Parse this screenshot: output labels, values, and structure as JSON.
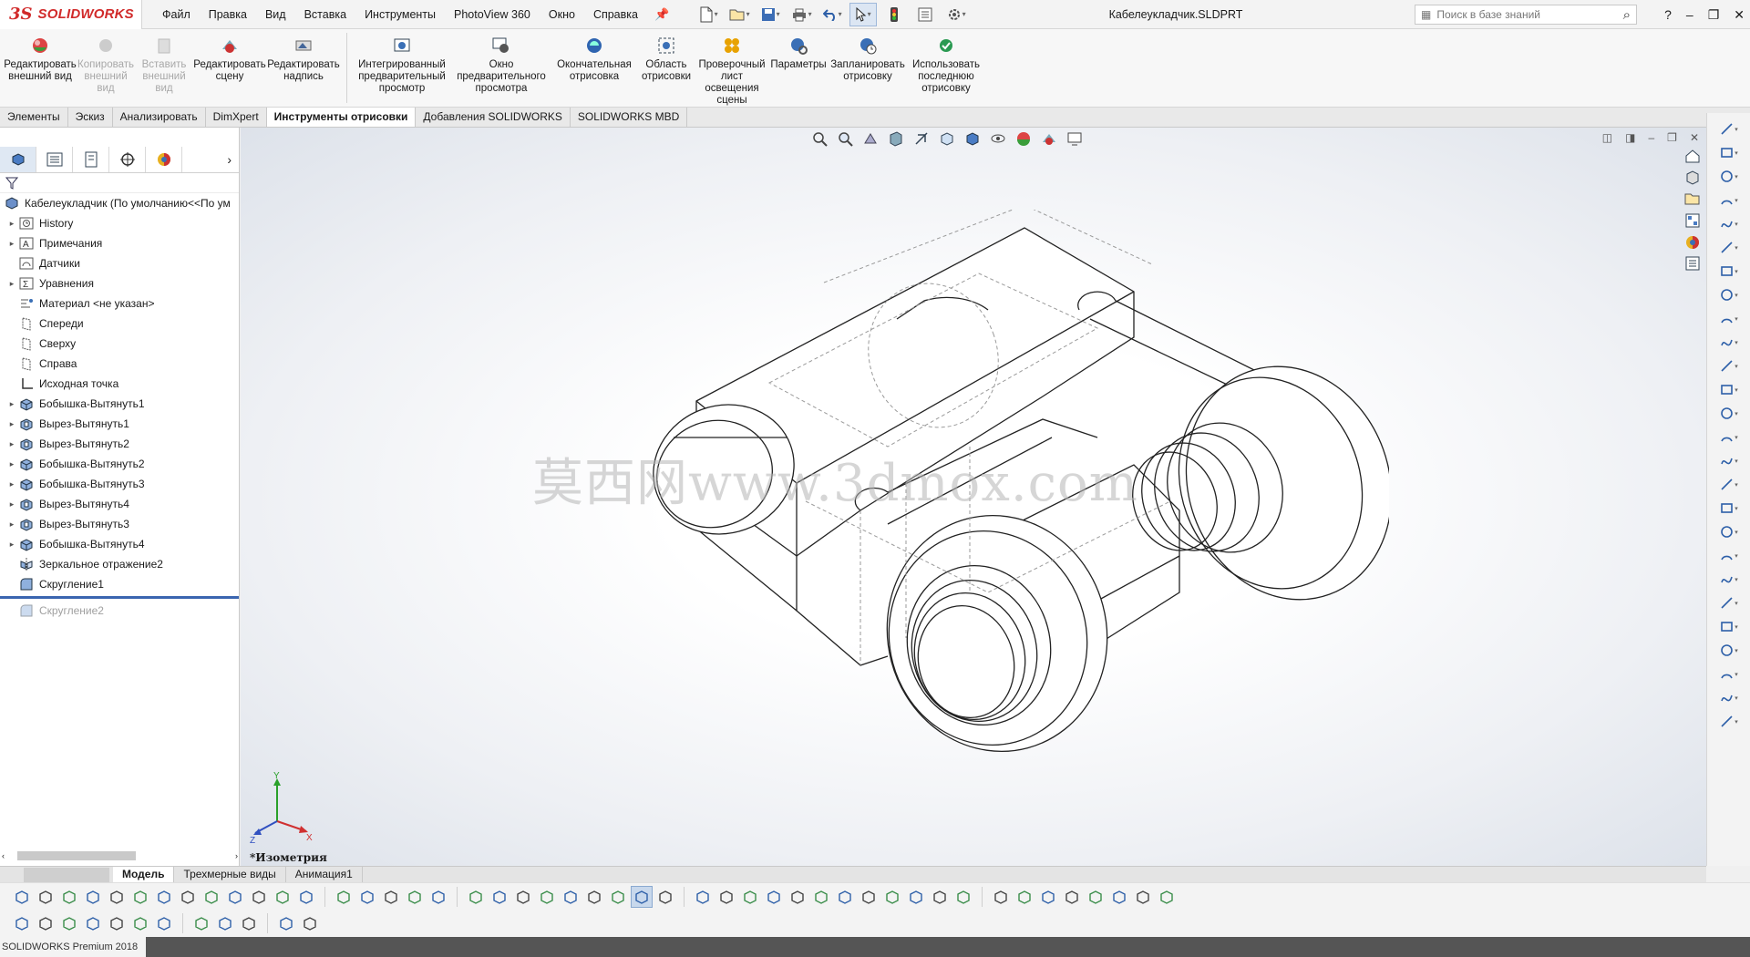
{
  "app": {
    "logo_ds": "3S",
    "logo_name": "SOLIDWORKS",
    "document_title": "Кабелеукладчик.SLDPRT"
  },
  "menu": [
    "Файл",
    "Правка",
    "Вид",
    "Вставка",
    "Инструменты",
    "PhotoView 360",
    "Окно",
    "Справка"
  ],
  "search": {
    "placeholder": "Поиск в базе знаний"
  },
  "window_controls": {
    "help": "?",
    "minimize": "–",
    "restore": "❐",
    "close": "✕"
  },
  "ribbon": [
    {
      "label": "Редактировать внешний вид",
      "icon": "appearance-icon",
      "enabled": true
    },
    {
      "label": "Копировать внешний вид",
      "icon": "copy-appearance-icon",
      "enabled": false
    },
    {
      "label": "Вставить внешний вид",
      "icon": "paste-appearance-icon",
      "enabled": false
    },
    {
      "label": "Редактировать сцену",
      "icon": "scene-icon",
      "enabled": true
    },
    {
      "label": "Редактировать надпись",
      "icon": "decal-icon",
      "enabled": true
    },
    {
      "label": "Интегрированный предварительный просмотр",
      "icon": "integrated-preview-icon",
      "enabled": true
    },
    {
      "label": "Окно предварительного просмотра",
      "icon": "preview-window-icon",
      "enabled": true
    },
    {
      "label": "Окончательная отрисовка",
      "icon": "final-render-icon",
      "enabled": true
    },
    {
      "label": "Область отрисовки",
      "icon": "render-region-icon",
      "enabled": true
    },
    {
      "label": "Проверочный лист освещения сцены",
      "icon": "illumination-proof-icon",
      "enabled": true
    },
    {
      "label": "Параметры",
      "icon": "options-icon",
      "enabled": true
    },
    {
      "label": "Запланировать отрисовку",
      "icon": "schedule-render-icon",
      "enabled": true
    },
    {
      "label": "Использовать последнюю отрисовку",
      "icon": "recall-render-icon",
      "enabled": true
    }
  ],
  "tabs": [
    {
      "label": "Элементы",
      "active": false
    },
    {
      "label": "Эскиз",
      "active": false
    },
    {
      "label": "Анализировать",
      "active": false
    },
    {
      "label": "DimXpert",
      "active": false
    },
    {
      "label": "Инструменты отрисовки",
      "active": true
    },
    {
      "label": "Добавления SOLIDWORKS",
      "active": false
    },
    {
      "label": "SOLIDWORKS MBD",
      "active": false
    }
  ],
  "feature_tree": {
    "root": "Кабелеукладчик  (По умолчанию<<По ум",
    "items": [
      {
        "label": "History",
        "icon": "history-icon",
        "expandable": true
      },
      {
        "label": "Примечания",
        "icon": "annotations-icon",
        "expandable": true
      },
      {
        "label": "Датчики",
        "icon": "sensors-icon",
        "expandable": false
      },
      {
        "label": "Уравнения",
        "icon": "equations-icon",
        "expandable": true
      },
      {
        "label": "Материал <не указан>",
        "icon": "material-icon",
        "expandable": false
      },
      {
        "label": "Спереди",
        "icon": "plane-icon",
        "expandable": false
      },
      {
        "label": "Сверху",
        "icon": "plane-icon",
        "expandable": false
      },
      {
        "label": "Справа",
        "icon": "plane-icon",
        "expandable": false
      },
      {
        "label": "Исходная точка",
        "icon": "origin-icon",
        "expandable": false
      },
      {
        "label": "Бобышка-Вытянуть1",
        "icon": "boss-extrude-icon",
        "expandable": true
      },
      {
        "label": "Вырез-Вытянуть1",
        "icon": "cut-extrude-icon",
        "expandable": true
      },
      {
        "label": "Вырез-Вытянуть2",
        "icon": "cut-extrude-icon",
        "expandable": true
      },
      {
        "label": "Бобышка-Вытянуть2",
        "icon": "boss-extrude-icon",
        "expandable": true
      },
      {
        "label": "Бобышка-Вытянуть3",
        "icon": "boss-extrude-icon",
        "expandable": true
      },
      {
        "label": "Вырез-Вытянуть4",
        "icon": "cut-extrude-icon",
        "expandable": true
      },
      {
        "label": "Вырез-Вытянуть3",
        "icon": "cut-extrude-icon",
        "expandable": true
      },
      {
        "label": "Бобышка-Вытянуть4",
        "icon": "boss-extrude-icon",
        "expandable": true
      },
      {
        "label": "Зеркальное отражение2",
        "icon": "mirror-icon",
        "expandable": false
      },
      {
        "label": "Скругление1",
        "icon": "fillet-icon",
        "expandable": false
      }
    ],
    "suppressed": {
      "label": "Скругление2",
      "icon": "fillet-icon"
    }
  },
  "viewport": {
    "watermark": "莫西网www.3dmox.com",
    "view_name": "*Изометрия",
    "triad": {
      "x": "X",
      "y": "Y",
      "z": "Z"
    }
  },
  "bottom_tabs": [
    {
      "label": "Модель",
      "active": true
    },
    {
      "label": "Трехмерные виды",
      "active": false
    },
    {
      "label": "Анимация1",
      "active": false
    }
  ],
  "status": {
    "text": "SOLIDWORKS Premium 2018"
  },
  "colors": {
    "brand": "#d12a2a",
    "accent": "#3a65b0"
  }
}
